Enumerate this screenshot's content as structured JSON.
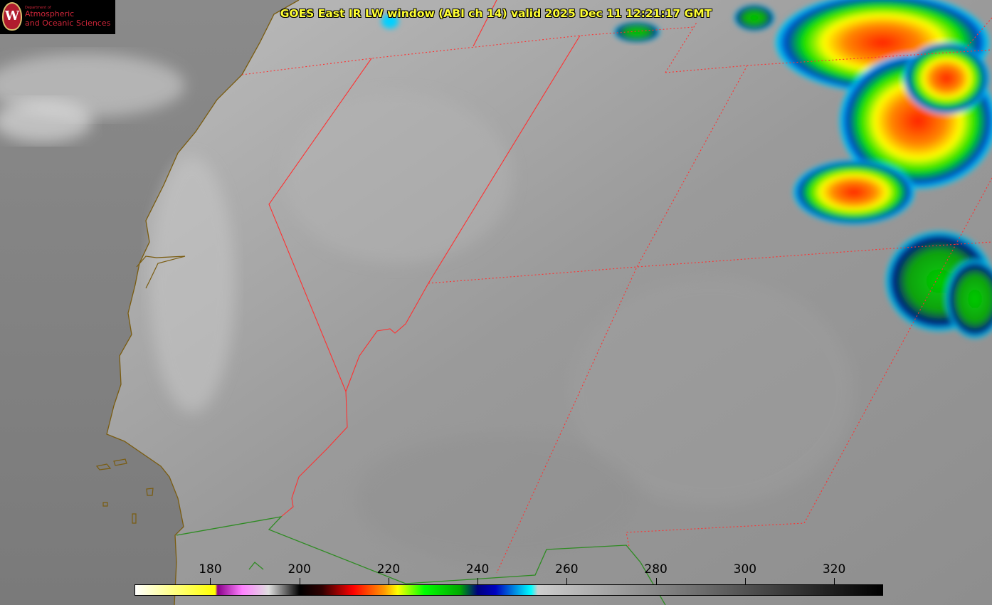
{
  "title": "GOES East IR LW window (ABI ch 14) valid 2025 Dec 11 12:21:17 GMT",
  "logo": {
    "department_line": "Department of",
    "line1": "Atmospheric",
    "line2": "and Oceanic Sciences",
    "seal_letter": "W"
  },
  "colorbar": {
    "units_range": [
      163,
      331
    ],
    "ticks": [
      "180",
      "200",
      "220",
      "240",
      "260",
      "280",
      "300",
      "320"
    ],
    "tick_values": [
      180,
      200,
      220,
      240,
      260,
      280,
      300,
      320
    ],
    "stops": [
      {
        "value": 163,
        "color": "#ffffff"
      },
      {
        "value": 181,
        "color": "#ffff00"
      },
      {
        "value": 181.5,
        "color": "#8a008a"
      },
      {
        "value": 187,
        "color": "#ff80ff"
      },
      {
        "value": 193,
        "color": "#e0e0e0"
      },
      {
        "value": 200,
        "color": "#000000"
      },
      {
        "value": 205,
        "color": "#300000"
      },
      {
        "value": 212,
        "color": "#ff0000"
      },
      {
        "value": 219,
        "color": "#ff9900"
      },
      {
        "value": 222,
        "color": "#ffff00"
      },
      {
        "value": 228,
        "color": "#00ff00"
      },
      {
        "value": 236,
        "color": "#00aa00"
      },
      {
        "value": 240,
        "color": "#000080"
      },
      {
        "value": 244,
        "color": "#0000c0"
      },
      {
        "value": 252,
        "color": "#00ffff"
      },
      {
        "value": 253.5,
        "color": "#cfcfcf"
      },
      {
        "value": 331,
        "color": "#000000"
      }
    ]
  },
  "map": {
    "colors": {
      "coastline": "#7a5c10",
      "international_border": "#2e8b22",
      "state_border": "#ff3030",
      "dotted_border": "#ff3030"
    }
  }
}
